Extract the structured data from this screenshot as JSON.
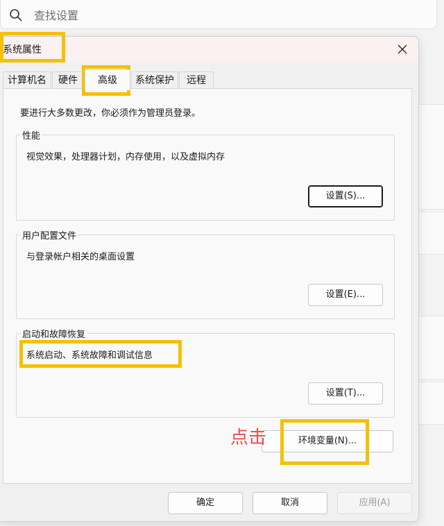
{
  "search": {
    "placeholder": "查找设置",
    "icon": "search-icon"
  },
  "dialog": {
    "title": "系统属性",
    "tabs": [
      {
        "label": "计算机名",
        "active": false
      },
      {
        "label": "硬件",
        "active": false
      },
      {
        "label": "高级",
        "active": true
      },
      {
        "label": "系统保护",
        "active": false
      },
      {
        "label": "远程",
        "active": false
      }
    ],
    "notice": "要进行大多数更改，你必须作为管理员登录。",
    "groups": {
      "performance": {
        "title": "性能",
        "desc": "视觉效果，处理器计划，内存使用，以及虚拟内存",
        "button": "设置(S)..."
      },
      "profiles": {
        "title": "用户配置文件",
        "desc": "与登录帐户相关的桌面设置",
        "button": "设置(E)..."
      },
      "startup": {
        "title": "启动和故障恢复",
        "desc": "系统启动、系统故障和调试信息",
        "button": "设置(T)..."
      }
    },
    "env_button": "环境变量(N)...",
    "footer": {
      "ok": "确定",
      "cancel": "取消",
      "apply": "应用(A)"
    }
  },
  "annotation": {
    "click_text": "点击",
    "highlight_color": "#f5c000",
    "text_color": "#e85050"
  }
}
